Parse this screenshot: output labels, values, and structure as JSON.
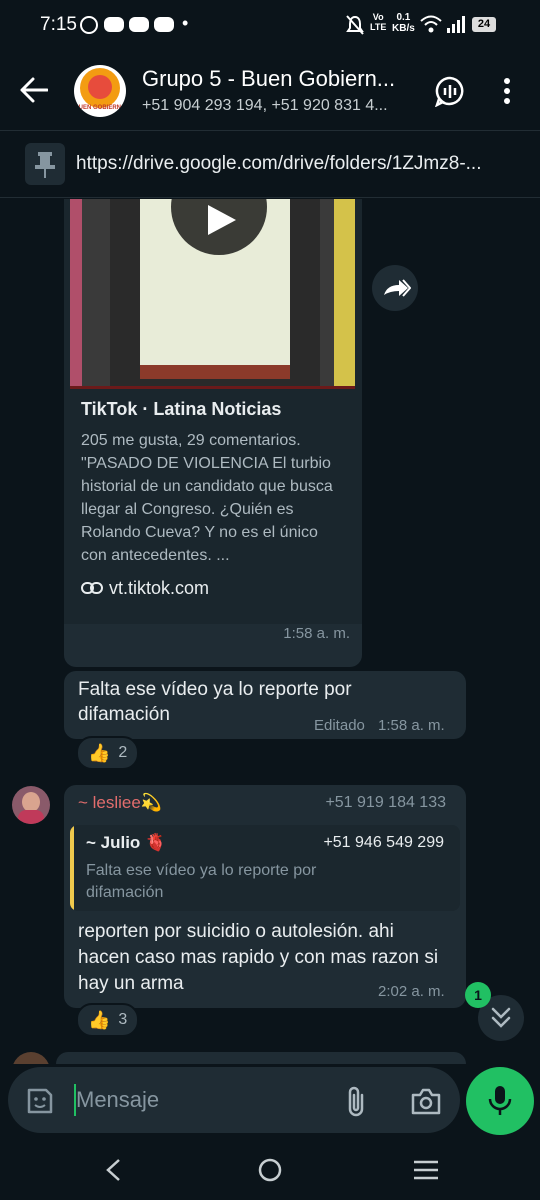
{
  "status": {
    "time": "7:15",
    "data_speed_value": "0.1",
    "data_speed_unit": "KB/s",
    "vo": "Vo",
    "lte": "LTE",
    "battery": "24",
    "dot": "•"
  },
  "header": {
    "title": "Grupo 5 - Buen Giern...",
    "title_full": "Grupo 5 - Buen Gobiern...",
    "subtitle": "+51 904 293 194, +51 920 831 4...",
    "avatar_text": "BUEN GOBIERNO"
  },
  "pinned": {
    "url": "https://drive.google.com/drive/folders/1ZJmz8-..."
  },
  "link_card": {
    "source": "TikTok · Latina Noticias",
    "description": "205 me gusta, 29 comentarios. \"PASADO DE VIOLENCIA El turbio historial de un candidato que busca llegar al Congreso. ¿Quién es Rolando Cueva? Y no es el único con antecedentes. ...",
    "domain": "vt.tiktok.com",
    "time": "1:58 a. m."
  },
  "msg1": {
    "text": "Falta ese vídeo ya lo reporte por difamación",
    "edited": "Editado",
    "time": "1:58 a. m.",
    "reaction_count": "2"
  },
  "msg2": {
    "sender": "~ lesliee💫",
    "phone": "+51 919 184 133",
    "quote_sender": "~ Julio 🫀",
    "quote_phone": "+51 946 549 299",
    "quote_text": "Falta ese vídeo ya lo reporte por difamación",
    "text": "reporten por suicidio o autolesión. ahi hacen caso mas rapido y con mas razon si hay un arma",
    "time": "2:02 a. m.",
    "reaction_count": "3"
  },
  "scroll_badge": "1",
  "composer": {
    "placeholder": "Mensaje"
  },
  "colors": {
    "accent": "#21c063",
    "sender": "#e26d6d",
    "quote_bar": "#f0c94d"
  }
}
